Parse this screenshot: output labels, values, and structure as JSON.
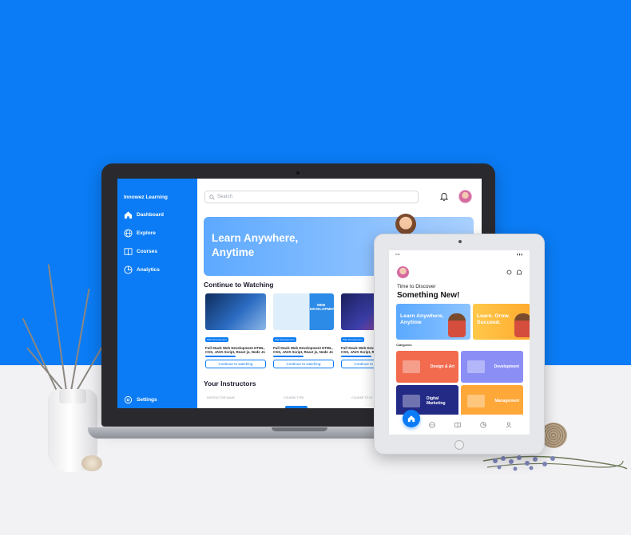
{
  "colors": {
    "brand": "#0b7cf5",
    "hero_start": "#5da9ff",
    "accent_orange": "#f26b4f",
    "accent_purple": "#8b8ff5",
    "accent_navy": "#232a86",
    "accent_yellow": "#ffa83a"
  },
  "web": {
    "brand": "Innowez Learning",
    "nav": [
      {
        "label": "Dashboard",
        "icon": "home-icon"
      },
      {
        "label": "Explore",
        "icon": "globe-icon"
      },
      {
        "label": "Courses",
        "icon": "book-icon"
      },
      {
        "label": "Analytics",
        "icon": "pie-chart-icon"
      }
    ],
    "settings_label": "Settings",
    "search_placeholder": "Search",
    "hero_title": "Learn Anywhere, Anytime",
    "continue_title": "Continue to Watching",
    "courses": [
      {
        "tag": "Web Development",
        "title": "Full Stack Web Development HTML, CSS, JAVA Script, React js, Node Js",
        "button": "Continue to watching",
        "thumb_text": ""
      },
      {
        "tag": "Web Development",
        "title": "Full Stack Web Development HTML, CSS, JAVA Script, React js, Node Js",
        "button": "Continue to watching",
        "thumb_text": "WEB DEVELOPMENT"
      },
      {
        "tag": "Web Development",
        "title": "Full Stack Web Development HTML, CSS, JAVA Script, React js, Node Js",
        "button": "Continue to watching",
        "thumb_text": ""
      }
    ],
    "instructors_title": "Your Instructors",
    "instructor_headers": [
      "INSTRUCTOR NAME",
      "COURSE TYPE",
      "COURSE TITLE"
    ]
  },
  "mobile": {
    "status_time": "9:41",
    "greeting": "Time to Discover",
    "title": "Something New!",
    "banners": [
      "Learn Anywhere, Anytime",
      "Learn. Grow. Succeed."
    ],
    "categories_label": "Categories",
    "categories": [
      "Design & Art",
      "Development",
      "Digital Marketing",
      "Management"
    ]
  }
}
